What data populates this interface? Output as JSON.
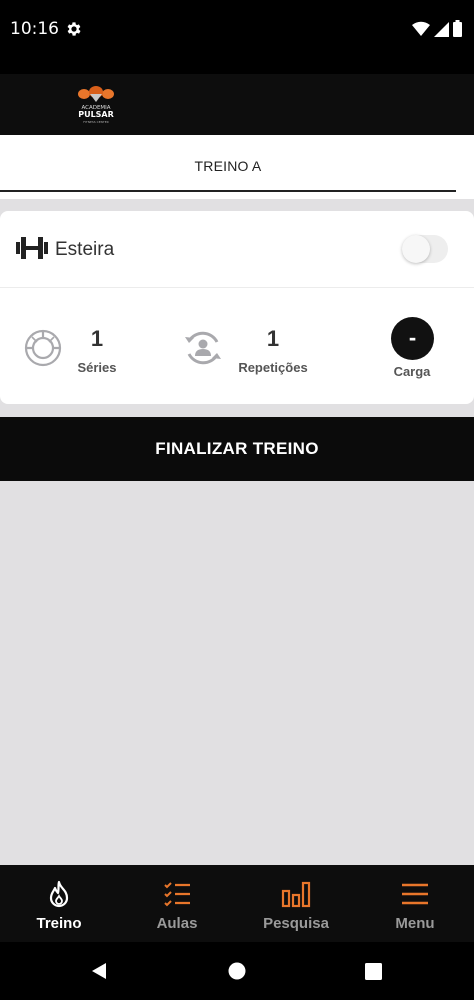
{
  "status_bar": {
    "time": "10:16",
    "icons": [
      "gear-icon",
      "wifi-icon",
      "signal-icon",
      "battery-icon"
    ]
  },
  "header": {
    "logo_line1": "ACADEMIA",
    "logo_line2": "PULSAR",
    "logo_tagline": "FITNESS CENTER"
  },
  "tabs": [
    {
      "label": "TREINO A",
      "active": true
    }
  ],
  "exercise": {
    "name": "Esteira",
    "icon": "dumbbell-icon",
    "toggle_on": false,
    "stats": {
      "series": {
        "value": "1",
        "label": "Séries",
        "icon": "series-icon"
      },
      "reps": {
        "value": "1",
        "label": "Repetições",
        "icon": "reps-icon"
      },
      "load": {
        "value": "-",
        "label": "Carga"
      }
    }
  },
  "finish_button": {
    "label": "FINALIZAR TREINO"
  },
  "bottom_nav": {
    "items": [
      {
        "label": "Treino",
        "icon": "flame-icon",
        "active": true
      },
      {
        "label": "Aulas",
        "icon": "checklist-icon",
        "active": false
      },
      {
        "label": "Pesquisa",
        "icon": "bar-chart-icon",
        "active": false
      },
      {
        "label": "Menu",
        "icon": "menu-icon",
        "active": false
      }
    ]
  },
  "system_nav": {
    "icons": [
      "back-icon",
      "home-icon",
      "recents-icon"
    ]
  },
  "colors": {
    "accent": "#e8762b",
    "dark": "#0d0d0d",
    "background": "#e1e0e2"
  }
}
